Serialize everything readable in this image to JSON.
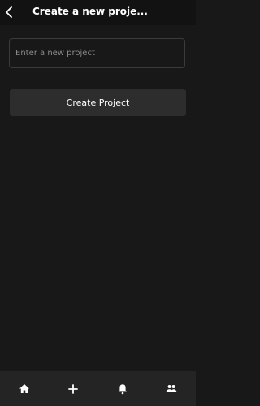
{
  "header": {
    "title": "Create a new proje...",
    "back_icon": "chevron-left-icon"
  },
  "form": {
    "project_name": {
      "value": "",
      "placeholder": "Enter a new project"
    },
    "submit_label": "Create Project"
  },
  "bottom_nav": {
    "items": [
      {
        "icon": "home-icon"
      },
      {
        "icon": "plus-icon"
      },
      {
        "icon": "bell-icon"
      },
      {
        "icon": "people-icon"
      }
    ]
  },
  "colors": {
    "background": "#181818",
    "header_background": "#121212",
    "nav_background": "#242424",
    "button_background": "#2d2d2d",
    "input_border": "#3b3b3b",
    "text": "#ffffff",
    "placeholder": "#8a8a8a"
  }
}
